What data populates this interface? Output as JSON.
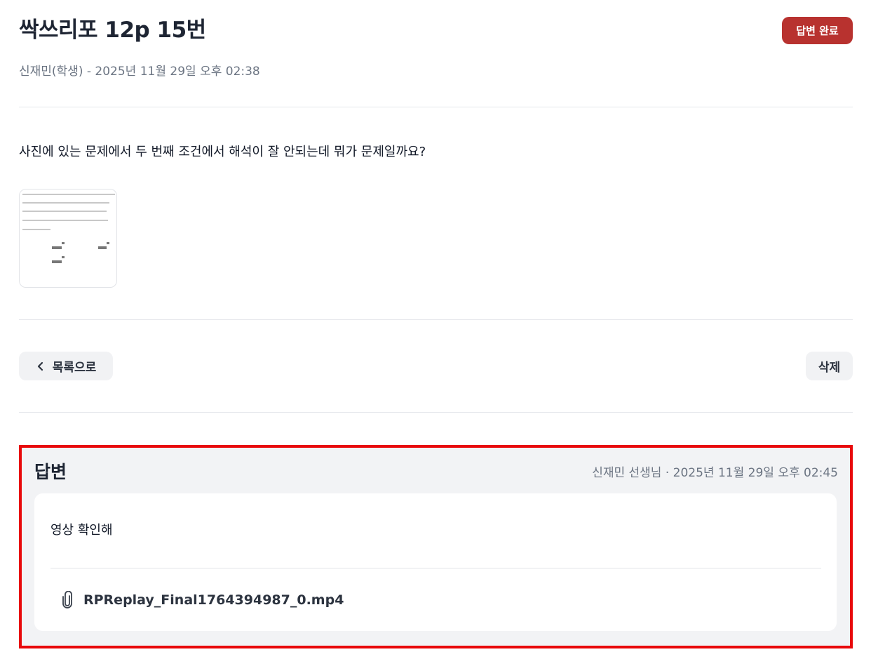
{
  "post": {
    "title": "싹쓰리포 12p 15번",
    "status_badge": "답변 완료",
    "author_meta": "신재민(학생) - 2025년 11월 29일 오후 02:38",
    "question": "사진에 있는 문제에서 두 번째 조건에서 해석이 잘 안되는데 뭐가 문제일까요?"
  },
  "actions": {
    "back_label": "목록으로",
    "delete_label": "삭제"
  },
  "answer": {
    "heading": "답변",
    "meta": "신재민 선생님 · 2025년 11월 29일 오후 02:45",
    "text": "영상 확인해",
    "attachment_name": "RPReplay_Final1764394987_0.mp4",
    "attachment_icon": "paperclip-icon"
  },
  "colors": {
    "badge": "#b8322f",
    "highlight_border": "#e8090b",
    "answer_background": "#f2f3f5"
  }
}
